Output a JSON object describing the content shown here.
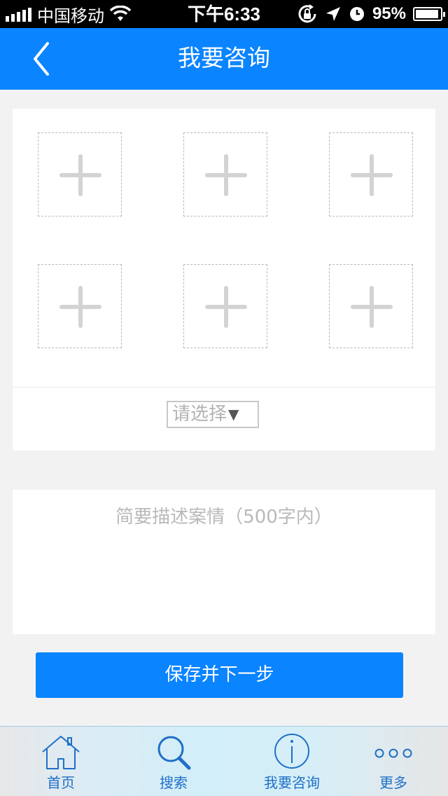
{
  "status_bar": {
    "carrier": "中国移动",
    "time": "下午6:33",
    "battery_percent": "95%",
    "battery_level": 0.95
  },
  "nav": {
    "title": "我要咨询"
  },
  "photo_upload": {
    "slot_count": 6
  },
  "category": {
    "value": "请选择",
    "arrow": "▼"
  },
  "description": {
    "placeholder": "简要描述案情（500字内）"
  },
  "save_button": {
    "label": "保存并下一步"
  },
  "tabs": [
    {
      "label": "首页",
      "icon": "home-icon"
    },
    {
      "label": "搜索",
      "icon": "search-icon"
    },
    {
      "label": "我要咨询",
      "icon": "info-icon"
    },
    {
      "label": "更多",
      "icon": "more-icon"
    }
  ],
  "colors": {
    "primary": "#0a84ff",
    "tab_label": "#1f6fc8",
    "placeholder": "#b9b9b9"
  }
}
